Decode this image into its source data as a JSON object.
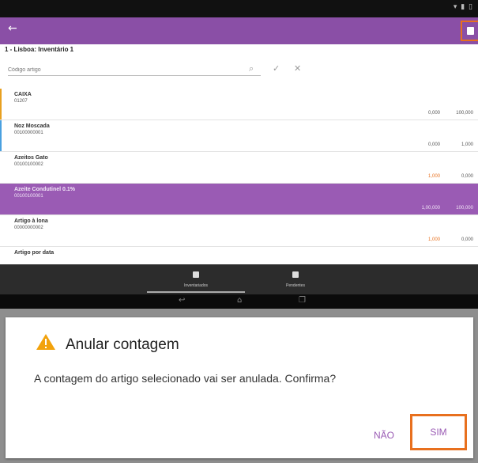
{
  "app": {
    "title": "1 - Lisboa: Inventário 1"
  },
  "search": {
    "placeholder": "Código artigo"
  },
  "items": [
    {
      "name": "CAIXA",
      "code": "01207",
      "qty_counted": "0,000",
      "qty_expected": "100,000",
      "accent": "#e8a020"
    },
    {
      "name": "Noz Moscada",
      "code": "00100000001",
      "qty_counted": "0,000",
      "qty_expected": "1,000",
      "accent": "#4aa0e0"
    },
    {
      "name": "Azeitos Gato",
      "code": "00100100002",
      "qty_counted": "1,000",
      "qty_expected": "0,000",
      "accent": ""
    },
    {
      "name": "Azeite Condutinel 0.1%",
      "code": "00100100001",
      "qty_counted": "1,00,000",
      "qty_expected": "100,000",
      "accent": "#9a5bb4"
    },
    {
      "name": "Artigo à lona",
      "code": "00000000002",
      "qty_counted": "1,000",
      "qty_expected": "0,000",
      "accent": ""
    },
    {
      "name": "Artigo por data",
      "code": "",
      "qty_counted": "",
      "qty_expected": "",
      "accent": ""
    }
  ],
  "bottom_nav": {
    "tabs": [
      {
        "label": "Inventariados"
      },
      {
        "label": "Pendentes"
      }
    ]
  },
  "dialog": {
    "title": "Anular contagem",
    "message": "A contagem do artigo selecionado vai ser anulada. Confirma?",
    "no_label": "NÃO",
    "yes_label": "SIM"
  },
  "colors": {
    "primary": "#8a4fa6",
    "highlight_border": "#e8701e",
    "warning": "#f2a20c"
  }
}
